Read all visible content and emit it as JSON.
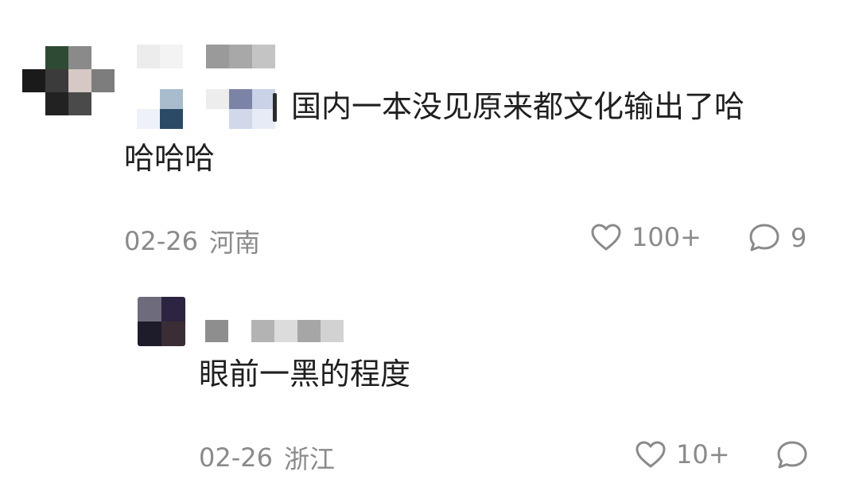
{
  "comments": [
    {
      "text_line1": "国内一本没见原来都文化输出了哈",
      "text_line2": "哈哈哈",
      "date": "02-26",
      "region": "河南",
      "likes": "100+",
      "replies": "9"
    },
    {
      "text": "眼前一黑的程度",
      "date": "02-26",
      "region": "浙江",
      "likes": "10+",
      "replies": ""
    }
  ],
  "icons": {
    "like": "heart-outline-icon",
    "reply": "speech-bubble-icon"
  },
  "colors": {
    "text": "#1f1f1f",
    "meta": "#8a8a8a",
    "background": "#ffffff"
  }
}
